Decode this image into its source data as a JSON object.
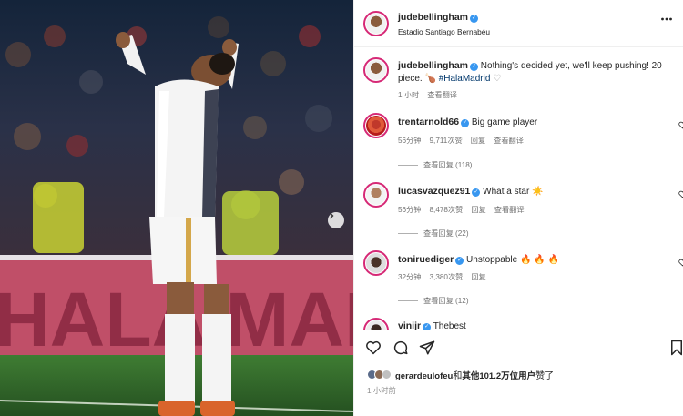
{
  "post": {
    "author": "judebellingham",
    "location": "Estadio Santiago Bernabéu",
    "caption_user": "judebellingham",
    "caption_text": "Nothing's decided yet, we'll keep pushing! 20 piece.",
    "caption_emoji": "🍗",
    "caption_hashtag": "#HalaMadrid",
    "caption_heart": "♡",
    "caption_time": "1 小时",
    "caption_translate": "查看翻译"
  },
  "comments": [
    {
      "user": "trentarnold66",
      "text": "Big game player",
      "time": "56分钟",
      "likes": "9,711次赞",
      "reply": "回复",
      "translate": "查看翻译",
      "view_replies": "查看回复 (118)"
    },
    {
      "user": "lucasvazquez91",
      "text": "What a star",
      "emoji": "☀️",
      "time": "56分钟",
      "likes": "8,478次赞",
      "reply": "回复",
      "translate": "查看翻译",
      "view_replies": "查看回复 (22)"
    },
    {
      "user": "toniruediger",
      "text": "Unstoppable",
      "emoji": "🔥 🔥 🔥",
      "time": "32分钟",
      "likes": "3,380次赞",
      "reply": "回复",
      "view_replies": "查看回复 (12)"
    },
    {
      "user": "vinijr",
      "text": "Thebest"
    }
  ],
  "likes": {
    "text_user": "gerardeulofeu",
    "text_and": "和",
    "text_others": "其他101.2万位用户",
    "text_suffix": "赞了"
  },
  "footer_time": "1 小时前",
  "photo": {
    "banner_text": "HALA MADRID HO"
  },
  "icons": {
    "like": "heart-icon",
    "comment": "comment-icon",
    "share": "send-icon",
    "save": "bookmark-icon",
    "more": "more-icon",
    "next": "chevron-right-icon"
  },
  "colors": {
    "verified": "#3897f0",
    "link": "#00376b",
    "muted": "#737373",
    "pitch": "#2f6b2a",
    "banner": "#b0475f"
  }
}
